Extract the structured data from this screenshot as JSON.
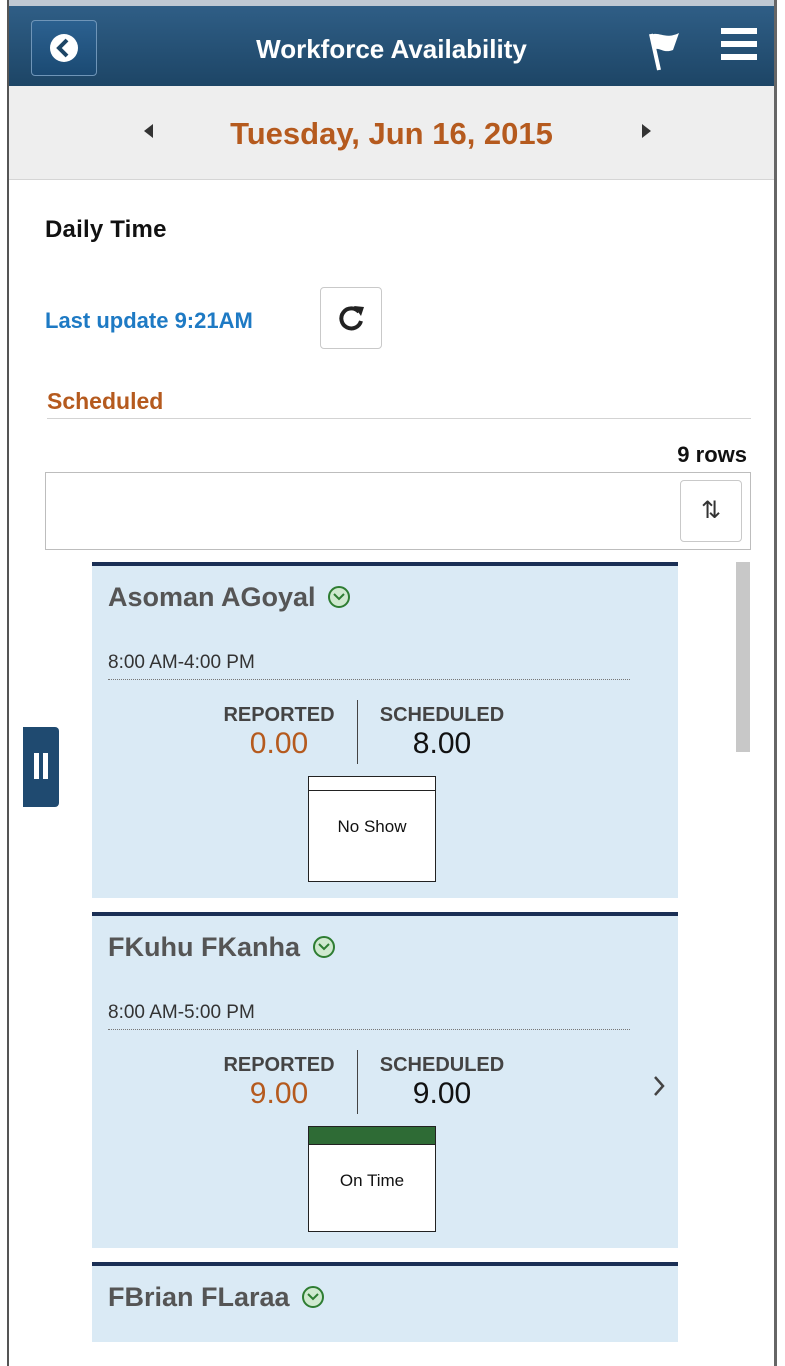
{
  "header": {
    "title": "Workforce Availability",
    "back_icon": "back-icon",
    "flag_icon": "flag-icon",
    "menu_icon": "hamburger-menu-icon"
  },
  "date_nav": {
    "date": "Tuesday, Jun 16, 2015"
  },
  "page": {
    "section_title": "Daily Time",
    "last_update": "Last update 9:21AM",
    "group_label": "Scheduled",
    "row_count": "9 rows",
    "sort_symbol": "⇅"
  },
  "cards": [
    {
      "name": "Asoman AGoyal",
      "time": "8:00 AM-4:00 PM",
      "reported_label": "REPORTED",
      "reported_value": "0.00",
      "scheduled_label": "SCHEDULED",
      "scheduled_value": "8.00",
      "status": "No Show",
      "status_color": "#ffffff"
    },
    {
      "name": "FKuhu FKanha",
      "time": "8:00 AM-5:00 PM",
      "reported_label": "REPORTED",
      "reported_value": "9.00",
      "scheduled_label": "SCHEDULED",
      "scheduled_value": "9.00",
      "status": "On Time",
      "status_color": "#2e6b35"
    },
    {
      "name": "FBrian FLaraa"
    }
  ],
  "colors": {
    "header_bg": "#1d4566",
    "accent_orange": "#b55a1e",
    "link_blue": "#1e7ac4",
    "card_bg": "#daeaf5"
  }
}
